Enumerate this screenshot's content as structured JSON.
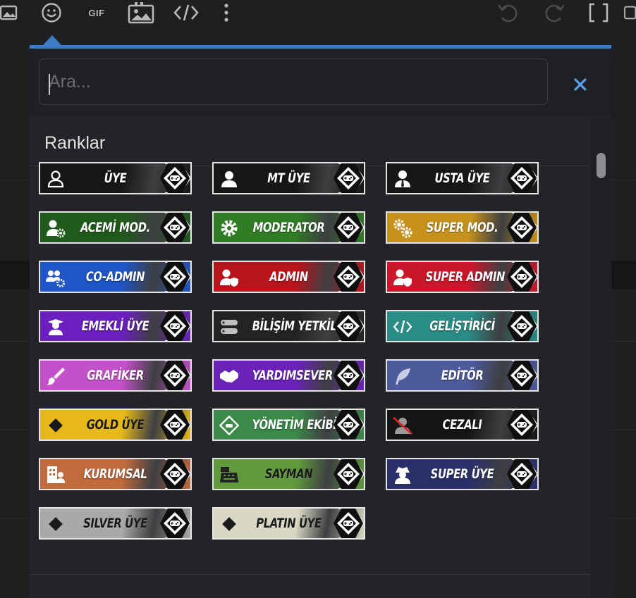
{
  "search": {
    "placeholder": "Ara..."
  },
  "section": {
    "title": "Ranklar"
  },
  "toolbar": {
    "gif_label": "GIF"
  },
  "badges": [
    {
      "label": "ÜYE",
      "icon": "user-outline-icon",
      "bg": "#161616",
      "color": "#ffffff"
    },
    {
      "label": "MT ÜYE",
      "icon": "user-icon",
      "bg": "#161616",
      "color": "#ffffff"
    },
    {
      "label": "USTA ÜYE",
      "icon": "user-tie-icon",
      "bg": "#161616",
      "color": "#ffffff"
    },
    {
      "label": "ACEMİ MOD.",
      "icon": "user-gear-icon",
      "bg": "#1f5a1a",
      "color": "#ffffff"
    },
    {
      "label": "MODERATOR",
      "icon": "gear-icon",
      "bg": "#2f7c24",
      "color": "#ffffff"
    },
    {
      "label": "SUPER MOD.",
      "icon": "gears-icon",
      "bg": "#c6921b",
      "color": "#ffffff"
    },
    {
      "label": "CO-ADMIN",
      "icon": "users-gear-icon",
      "bg": "#1f55c4",
      "color": "#ffffff"
    },
    {
      "label": "ADMIN",
      "icon": "user-shield-icon",
      "bg": "#b8141b",
      "color": "#ffffff"
    },
    {
      "label": "SUPER ADMIN",
      "icon": "user-shield-icon",
      "bg": "#c9172c",
      "color": "#ffffff"
    },
    {
      "label": "EMEKLİ ÜYE",
      "icon": "user-retired-icon",
      "bg": "#6b1fbf",
      "color": "#ffffff"
    },
    {
      "label": "BİLİŞİM YETKİLİSİ",
      "icon": "server-icon",
      "bg": "#232323",
      "color": "#ffffff"
    },
    {
      "label": "GELİŞTİRİCİ",
      "icon": "code-icon",
      "bg": "#2a8c86",
      "color": "#ffffff"
    },
    {
      "label": "GRAFİKER",
      "icon": "brush-icon",
      "bg": "#c451c9",
      "color": "#ffffff"
    },
    {
      "label": "YARDIMSEVER",
      "icon": "handshake-icon",
      "bg": "#6a22b8",
      "color": "#ffffff"
    },
    {
      "label": "EDİTÖR",
      "icon": "feather-icon",
      "bg": "#4d5a9c",
      "color": "#ffffff"
    },
    {
      "label": "GOLD ÜYE",
      "icon": "diamond-icon",
      "bg": "#e6b81a",
      "color": "#1a1a1a"
    },
    {
      "label": "YÖNETİM EKİBİ",
      "icon": "gamepad-diamond-icon",
      "bg": "#3c8a4a",
      "color": "#ffffff"
    },
    {
      "label": "CEZALI",
      "icon": "user-slash-icon",
      "bg": "#151515",
      "color": "#ffffff"
    },
    {
      "label": "KURUMSAL",
      "icon": "building-user-icon",
      "bg": "#c06a3e",
      "color": "#ffffff"
    },
    {
      "label": "SAYMAN",
      "icon": "cash-register-icon",
      "bg": "#5f9a3d",
      "color": "#1a1a1a"
    },
    {
      "label": "SUPER ÜYE",
      "icon": "user-secret-icon",
      "bg": "#2a2f6a",
      "color": "#ffffff"
    },
    {
      "label": "SILVER ÜYE",
      "icon": "diamond-icon",
      "bg": "#a9a9a9",
      "color": "#1a1a1a"
    },
    {
      "label": "PLATIN ÜYE",
      "icon": "diamond-icon",
      "bg": "#d9d8c4",
      "color": "#1a1a1a"
    }
  ]
}
